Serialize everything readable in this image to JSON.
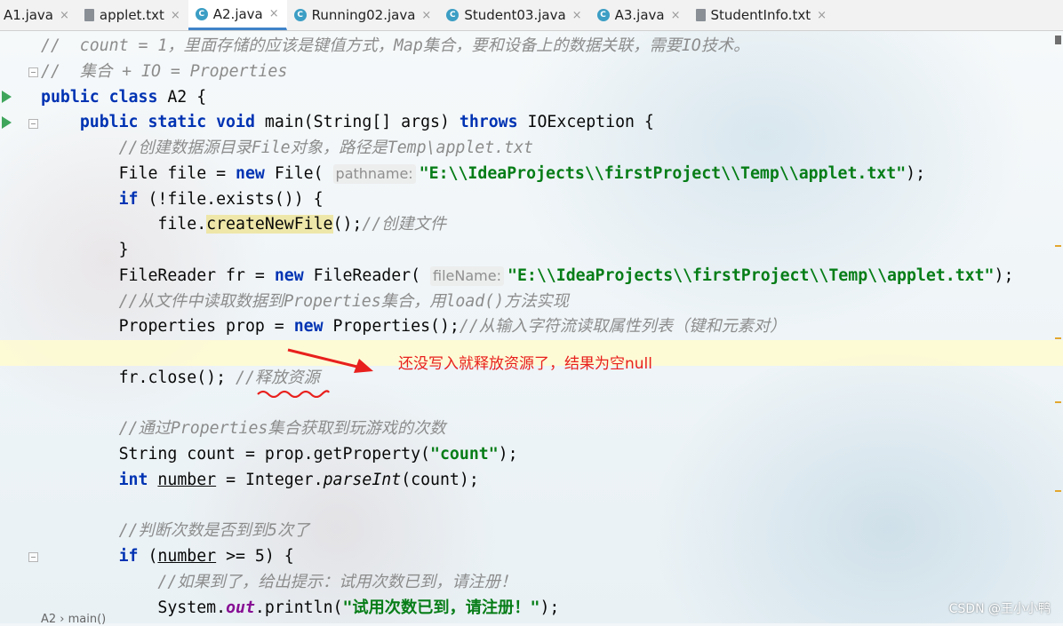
{
  "tabs": [
    {
      "label": "A1.java",
      "icon": "java-class-icon"
    },
    {
      "label": "applet.txt",
      "icon": "text-file-icon"
    },
    {
      "label": "A2.java",
      "icon": "java-class-icon",
      "active": true
    },
    {
      "label": "Running02.java",
      "icon": "java-class-icon"
    },
    {
      "label": "Student03.java",
      "icon": "java-class-icon"
    },
    {
      "label": "A3.java",
      "icon": "java-class-icon"
    },
    {
      "label": "StudentInfo.txt",
      "icon": "text-file-icon"
    }
  ],
  "tab_close_glyph": "×",
  "code": {
    "l1": "//  count = 1，里面存储的应该是键值方式，Map集合，要和设备上的数据关联，需要IO技术。",
    "l2": "//  集合 + IO = Properties",
    "l3_kw": "public class",
    "l3_rest": " A2 {",
    "l4_kw": "public static void",
    "l4_mid": " main(String[] args) ",
    "l4_kw2": "throws",
    "l4_rest": " IOException {",
    "l5": "//创建数据源目录File对象，路径是Temp\\applet.txt",
    "l6_a": "File file = ",
    "l6_kw": "new",
    "l6_b": " File( ",
    "l6_hint": "pathname:",
    "l6_str": "\"E:\\\\IdeaProjects\\\\firstProject\\\\Temp\\\\applet.txt\"",
    "l6_end": ");",
    "l7_kw": "if",
    "l7_rest": " (!file.exists()) {",
    "l8_a": "file.",
    "l8_mark": "createNewFile",
    "l8_b": "();",
    "l8_cm": "//创建文件",
    "l9": "}",
    "l10_a": "FileReader fr = ",
    "l10_kw": "new",
    "l10_b": " FileReader( ",
    "l10_hint": "fileName:",
    "l10_str": "\"E:\\\\IdeaProjects\\\\firstProject\\\\Temp\\\\applet.txt\"",
    "l10_end": ");",
    "l11": "//从文件中读取数据到Properties集合，用load()方法实现",
    "l12_a": "Properties prop = ",
    "l12_kw": "new",
    "l12_b": " Properties();",
    "l12_cm": "//从输入字符流读取属性列表（键和元素对）",
    "l14_a": "fr.close(); ",
    "l14_cm": "//释放资源",
    "l16": "//通过Properties集合获取到玩游戏的次数",
    "l17_a": "String count = prop.getProperty(",
    "l17_str": "\"count\"",
    "l17_end": ");",
    "l18_kw": "int",
    "l18_var": "number",
    "l18_a": " = Integer.",
    "l18_it": "parseInt",
    "l18_end": "(count);",
    "l20": "//判断次数是否到到5次了",
    "l21_kw": "if",
    "l21_a": " (",
    "l21_var": "number",
    "l21_end": " >= 5) {",
    "l22": "//如果到了，给出提示：试用次数已到，请注册！",
    "l23_a": "System.",
    "l23_fld": "out",
    "l23_b": ".println(",
    "l23_str": "\"试用次数已到，请注册！\"",
    "l23_end": ");"
  },
  "annotation": "还没写入就释放资源了，结果为空null",
  "annotation_color": "#e8201d",
  "breadcrumb": "A2  ›  main()",
  "watermark": "CSDN @王小小鸭",
  "colors": {
    "keyword": "#0033b3",
    "comment": "#8c8c8c",
    "string": "#067d17",
    "active_tab_underline": "#4083c9"
  }
}
